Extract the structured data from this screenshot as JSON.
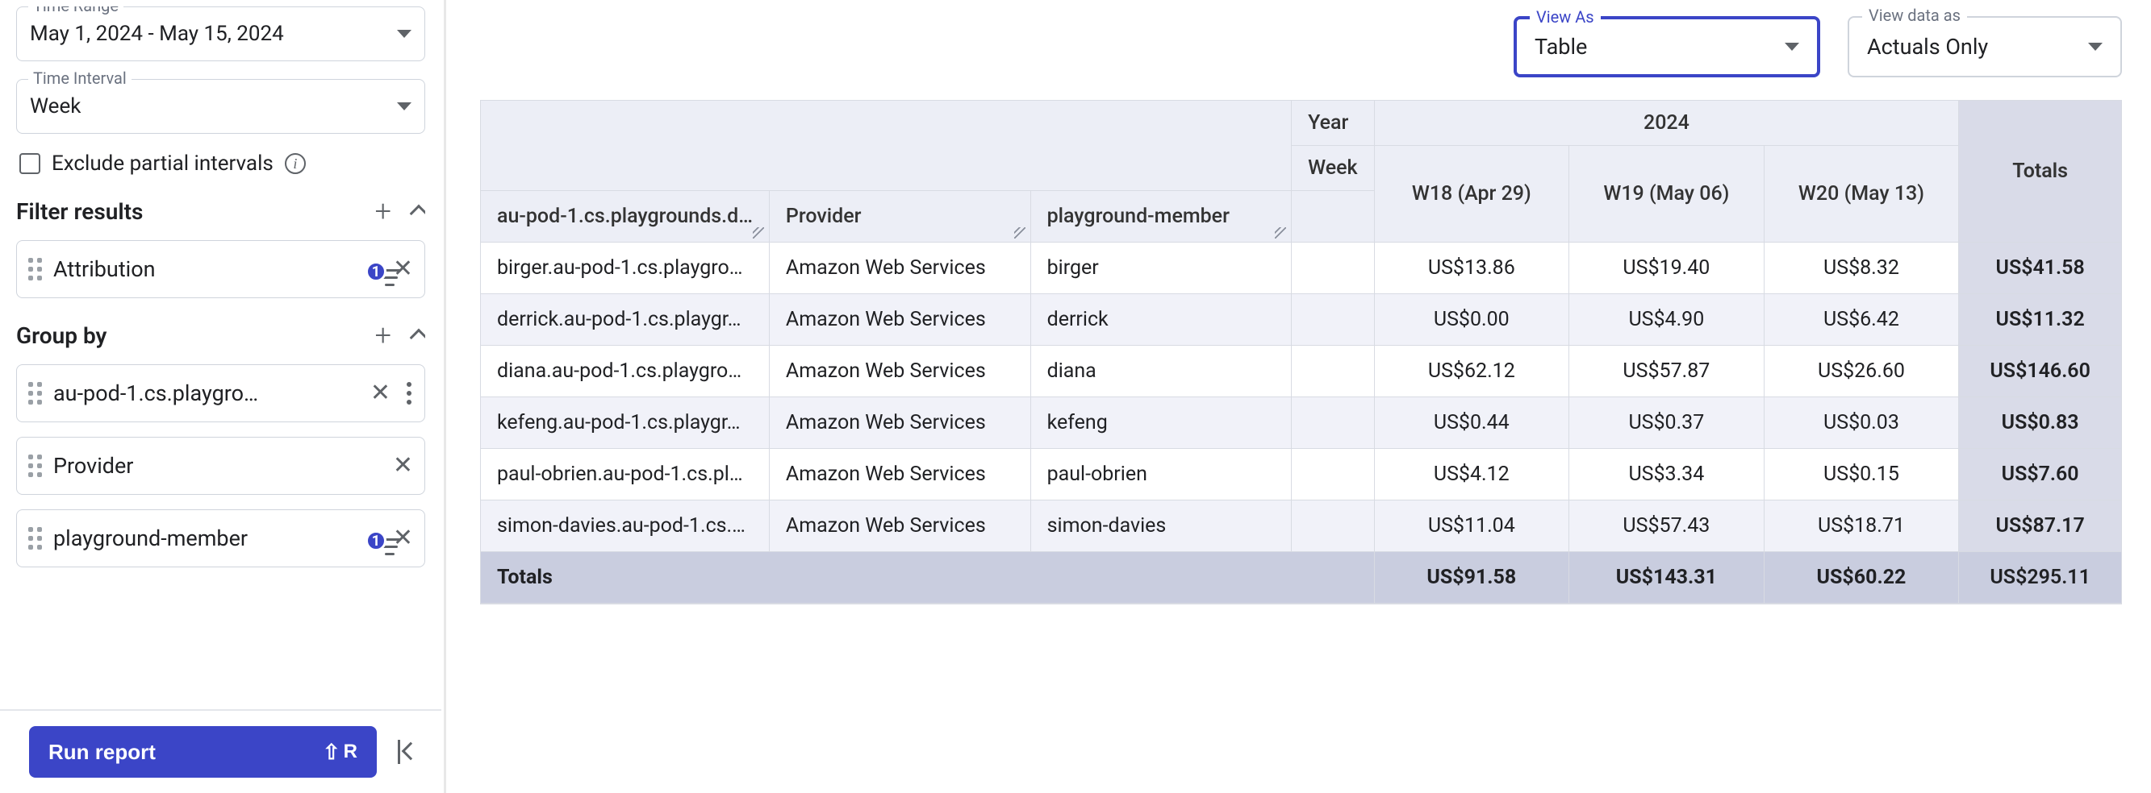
{
  "sidebar": {
    "time_range": {
      "legend": "Time Range",
      "value": "May 1, 2024 - May 15, 2024"
    },
    "time_interval": {
      "legend": "Time Interval",
      "value": "Week"
    },
    "exclude_partial_label": "Exclude partial intervals",
    "filter_section": {
      "title": "Filter results"
    },
    "filter_chip": {
      "label": "Attribution",
      "badge": "1"
    },
    "groupby_section": {
      "title": "Group by"
    },
    "group_chips": [
      {
        "label": "au-pod-1.cs.playgro…"
      },
      {
        "label": "Provider"
      },
      {
        "label": "playground-member",
        "badge": "1"
      }
    ],
    "run_button": {
      "label": "Run report",
      "shortcut": "R"
    }
  },
  "header": {
    "view_as": {
      "legend": "View As",
      "value": "Table"
    },
    "view_data_as": {
      "legend": "View data as",
      "value": "Actuals Only"
    }
  },
  "table": {
    "year_label": "Year",
    "year_value": "2024",
    "week_label": "Week",
    "totals_label": "Totals",
    "dim_headers": [
      "au-pod-1.cs.playgrounds.d…",
      "Provider",
      "playground-member"
    ],
    "week_headers": [
      "W18 (Apr 29)",
      "W19 (May 06)",
      "W20 (May 13)"
    ],
    "rows": [
      {
        "dims": [
          "birger.au-pod-1.cs.playgro…",
          "Amazon Web Services",
          "birger"
        ],
        "cells": [
          "US$13.86",
          "US$19.40",
          "US$8.32"
        ],
        "total": "US$41.58"
      },
      {
        "dims": [
          "derrick.au-pod-1.cs.playgr…",
          "Amazon Web Services",
          "derrick"
        ],
        "cells": [
          "US$0.00",
          "US$4.90",
          "US$6.42"
        ],
        "total": "US$11.32"
      },
      {
        "dims": [
          "diana.au-pod-1.cs.playgro…",
          "Amazon Web Services",
          "diana"
        ],
        "cells": [
          "US$62.12",
          "US$57.87",
          "US$26.60"
        ],
        "total": "US$146.60"
      },
      {
        "dims": [
          "kefeng.au-pod-1.cs.playgr…",
          "Amazon Web Services",
          "kefeng"
        ],
        "cells": [
          "US$0.44",
          "US$0.37",
          "US$0.03"
        ],
        "total": "US$0.83"
      },
      {
        "dims": [
          "paul-obrien.au-pod-1.cs.pl…",
          "Amazon Web Services",
          "paul-obrien"
        ],
        "cells": [
          "US$4.12",
          "US$3.34",
          "US$0.15"
        ],
        "total": "US$7.60"
      },
      {
        "dims": [
          "simon-davies.au-pod-1.cs.…",
          "Amazon Web Services",
          "simon-davies"
        ],
        "cells": [
          "US$11.04",
          "US$57.43",
          "US$18.71"
        ],
        "total": "US$87.17"
      }
    ],
    "footer": {
      "label": "Totals",
      "cells": [
        "US$91.58",
        "US$143.31",
        "US$60.22"
      ],
      "total": "US$295.11"
    }
  }
}
